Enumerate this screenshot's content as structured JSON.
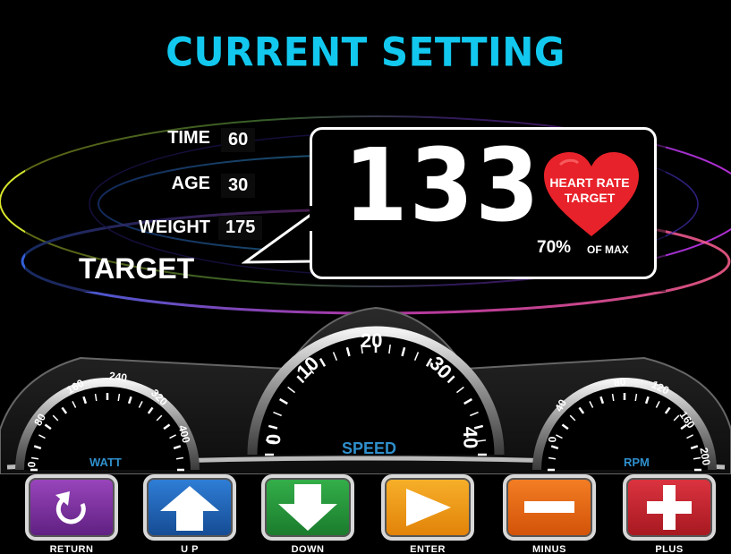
{
  "header": {
    "title": "CURRENT SETTING"
  },
  "settings": {
    "time": {
      "label": "TIME",
      "value": "60"
    },
    "age": {
      "label": "AGE",
      "value": "30"
    },
    "weight": {
      "label": "WEIGHT",
      "value": "175"
    },
    "target_label": "TARGET"
  },
  "heart_rate": {
    "value": "133",
    "caption_line1": "HEART RATE",
    "caption_line2": "TARGET",
    "percent": "70%",
    "of_max": "OF MAX"
  },
  "gauges": {
    "watt": {
      "label": "WATT",
      "ticks": [
        "0",
        "80",
        "160",
        "240",
        "320",
        "400"
      ]
    },
    "speed": {
      "label": "SPEED",
      "ticks": [
        "0",
        "10",
        "20",
        "30",
        "40"
      ]
    },
    "rpm": {
      "label": "RPM",
      "ticks": [
        "0",
        "40",
        "80",
        "120",
        "160",
        "200"
      ]
    }
  },
  "buttons": [
    {
      "label": "RETURN",
      "icon": "return-icon",
      "color": "#7a2f9c"
    },
    {
      "label": "U P",
      "icon": "arrow-up-icon",
      "color": "#1f63b8"
    },
    {
      "label": "DOWN",
      "icon": "arrow-down-icon",
      "color": "#249a3c"
    },
    {
      "label": "ENTER",
      "icon": "play-icon",
      "color": "#f39a12"
    },
    {
      "label": "MINUS",
      "icon": "minus-icon",
      "color": "#ea6a10"
    },
    {
      "label": "PLUS",
      "icon": "plus-icon",
      "color": "#c4222e"
    }
  ],
  "colors": {
    "title": "#12c8ee",
    "dial_label": "#2f8fcc",
    "heart": "#e8222a"
  }
}
